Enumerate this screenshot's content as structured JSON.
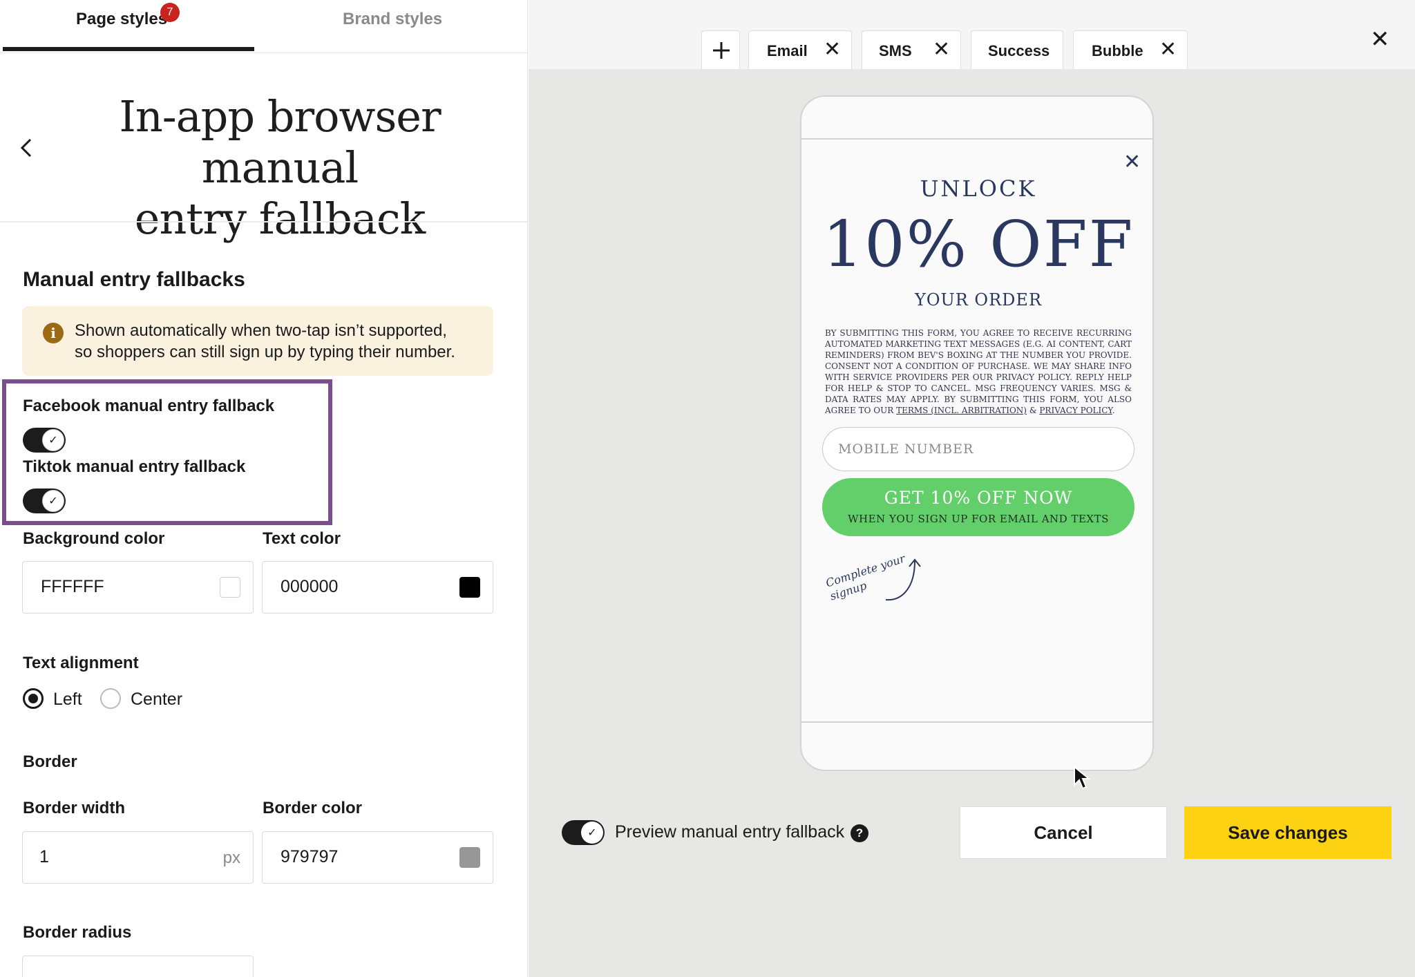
{
  "tabs": {
    "page_styles": "Page styles",
    "page_styles_badge": "7",
    "brand_styles": "Brand styles"
  },
  "title": {
    "line1": "In-app browser manual",
    "line2": "entry fallback"
  },
  "manual": {
    "heading": "Manual entry fallbacks",
    "notice_line1": "Shown automatically when two-tap isn’t supported,",
    "notice_line2": "so shoppers can still sign up by typing their number.",
    "facebook_label": "Facebook manual entry fallback",
    "facebook_on": true,
    "tiktok_label": "Tiktok manual entry fallback",
    "tiktok_on": true
  },
  "colors": {
    "background_label": "Background color",
    "background_value": "FFFFFF",
    "background_hex": "#FFFFFF",
    "text_label": "Text color",
    "text_value": "000000",
    "text_hex": "#000000"
  },
  "alignment": {
    "label": "Text alignment",
    "options": [
      "Left",
      "Center"
    ],
    "selected": "Left"
  },
  "border": {
    "heading": "Border",
    "width_label": "Border width",
    "width_value": "1",
    "width_unit": "px",
    "color_label": "Border color",
    "color_value": "979797",
    "color_hex": "#979797",
    "radius_label": "Border radius"
  },
  "preview_tabs": {
    "add_icon": "plus-icon",
    "items": [
      {
        "label": "Email",
        "closable": true
      },
      {
        "label": "SMS",
        "closable": true
      },
      {
        "label": "Success",
        "closable": false
      },
      {
        "label": "Bubble",
        "closable": true
      }
    ]
  },
  "popup": {
    "unlock": "UNLOCK",
    "offer": "10% OFF",
    "your_order": "YOUR ORDER",
    "legal_text": "By submitting this form, you agree to receive recurring automated marketing text messages (e.g. AI content, cart reminders) from Bev's Boxing at the number you provide. Consent not a condition of purchase. We may share info with service providers per our privacy policy. Reply HELP for help & STOP to cancel. Msg frequency varies. Msg & data rates may apply. By submitting this form, you also agree to our",
    "legal_link1": "Terms (incl. arbitration)",
    "legal_and": "&",
    "legal_link2": "Privacy Policy",
    "legal_end": ".",
    "mobile_placeholder": "MOBILE NUMBER",
    "cta_main": "GET 10% OFF NOW",
    "cta_sub": "WHEN YOU SIGN UP FOR EMAIL AND TEXTS",
    "hand_line1": "Complete your",
    "hand_line2": "signup",
    "cta_color": "#62CF6B",
    "text_color": "#2A3860"
  },
  "footer": {
    "preview_label": "Preview manual entry fallback",
    "preview_on": true,
    "cancel": "Cancel",
    "save": "Save changes",
    "save_color": "#FDD213"
  }
}
